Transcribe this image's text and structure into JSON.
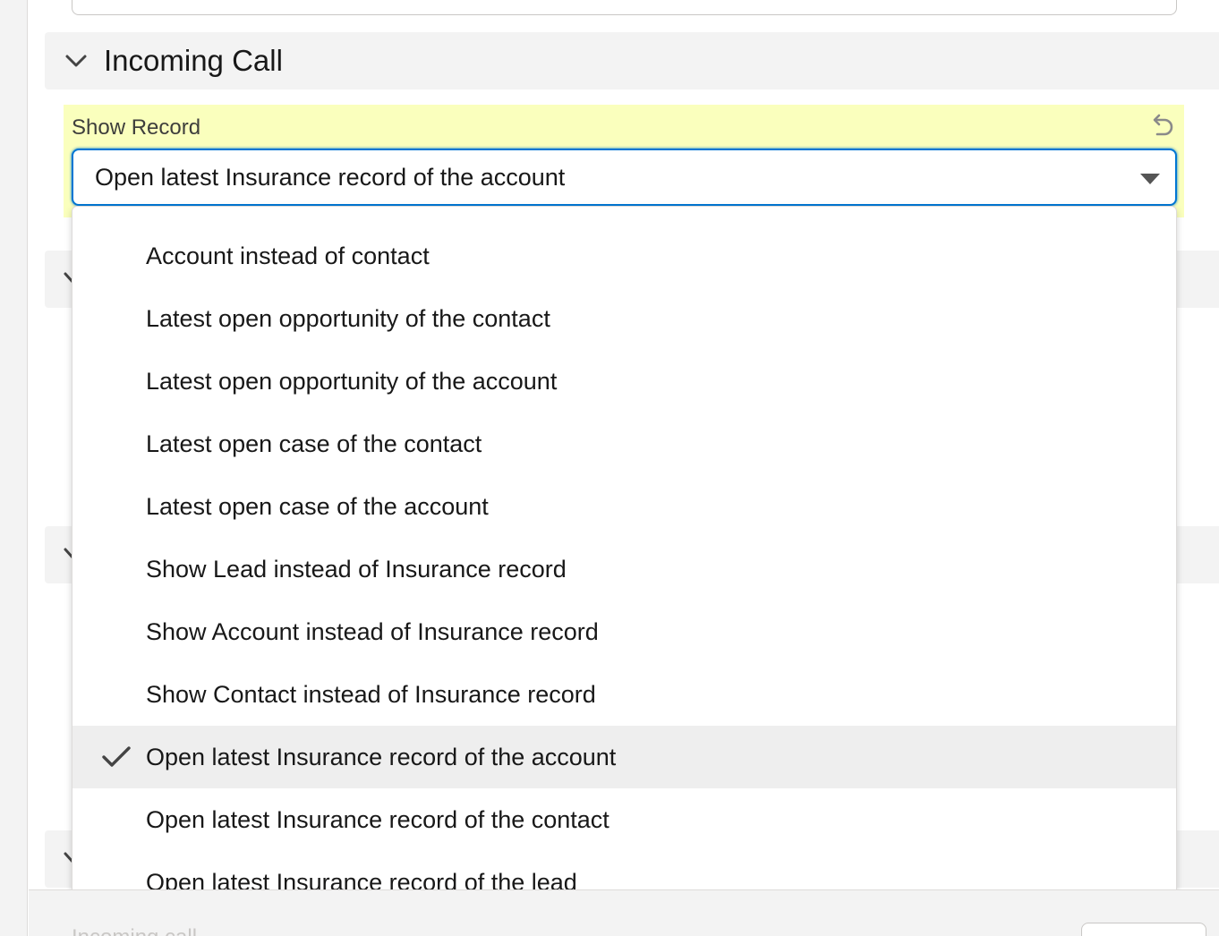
{
  "section": {
    "title": "Incoming Call"
  },
  "field": {
    "label": "Show Record",
    "value": "Open latest Insurance record of the account",
    "highlight_color": "#faffbd",
    "focus_color": "#0176d3"
  },
  "dropdown": {
    "options": [
      {
        "label": "Account instead of contact",
        "selected": false
      },
      {
        "label": "Latest open opportunity of the contact",
        "selected": false
      },
      {
        "label": "Latest open opportunity of the account",
        "selected": false
      },
      {
        "label": "Latest open case of the contact",
        "selected": false
      },
      {
        "label": "Latest open case of the account",
        "selected": false
      },
      {
        "label": "Show Lead instead of Insurance record",
        "selected": false
      },
      {
        "label": "Show Account instead of Insurance record",
        "selected": false
      },
      {
        "label": "Show Contact instead of Insurance record",
        "selected": false
      },
      {
        "label": "Open latest Insurance record of the account",
        "selected": true
      },
      {
        "label": "Open latest Insurance record of the contact",
        "selected": false
      },
      {
        "label": "Open latest Insurance record of the lead",
        "selected": false
      }
    ]
  },
  "footer": {
    "text": "Incoming call"
  },
  "icons": {
    "section_toggle": "chevron-down-icon",
    "undo": "undo-icon",
    "combobox_toggle": "caret-down-icon",
    "selected_marker": "check-icon"
  }
}
